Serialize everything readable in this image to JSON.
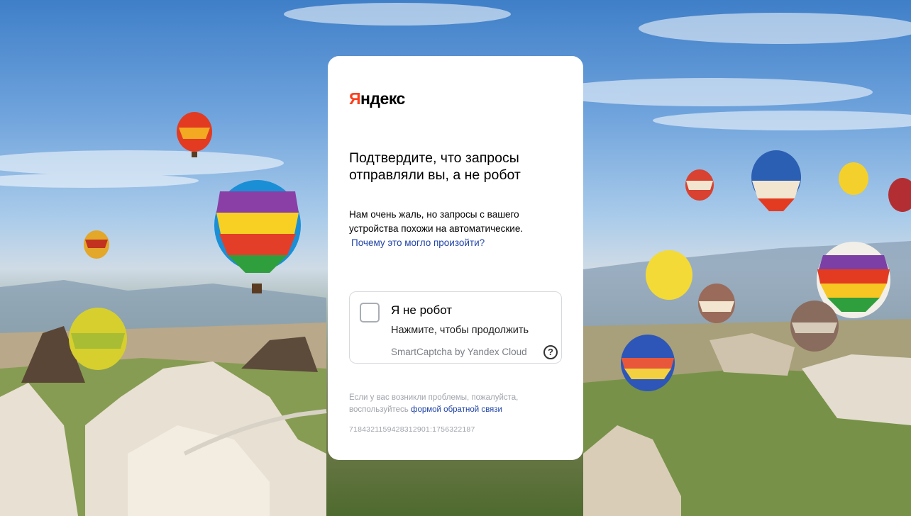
{
  "logo": {
    "first_letter": "Я",
    "rest": "ндекс"
  },
  "title": "Подтвердите, что запросы отправляли вы, а не робот",
  "description": "Нам очень жаль, но запросы с вашего устройства похожи на автоматические.",
  "why_link": "Почему это могло произойти?",
  "captcha": {
    "title": "Я не робот",
    "subtitle": "Нажмите, чтобы продолжить",
    "brand": "SmartCaptcha by Yandex Cloud",
    "help_symbol": "?"
  },
  "footer": {
    "text": "Если у вас возникли проблемы, пожалуйста, воспользуйтесь",
    "link": "формой обратной связи"
  },
  "request_id": "7184321159428312901:1756322187",
  "colors": {
    "brand_red": "#fc3f1d",
    "link_blue": "#2044a8",
    "muted_gray": "#a0a4ab"
  },
  "icons": [
    "checkbox-icon",
    "question-icon"
  ]
}
